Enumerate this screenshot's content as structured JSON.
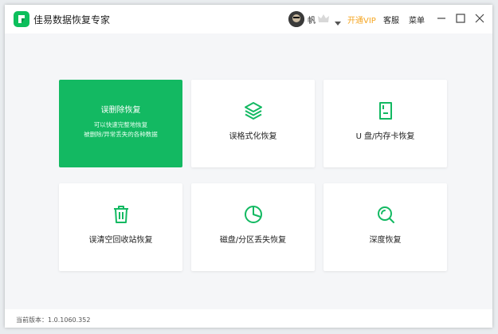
{
  "app": {
    "title": "佳易数据恢复专家"
  },
  "user": {
    "name": "帆"
  },
  "header": {
    "vip_label": "开通VIP",
    "service_label": "客服",
    "menu_label": "菜单"
  },
  "cards": [
    {
      "title": "误删除恢复",
      "desc1": "可以快速完整地恢复",
      "desc2": "被删除/异常丢失的各种数据",
      "icon": "recovery-icon"
    },
    {
      "label": "误格式化恢复",
      "icon": "layers-icon"
    },
    {
      "label": "U 盘/内存卡恢复",
      "icon": "sd-card-icon"
    },
    {
      "label": "误清空回收站恢复",
      "icon": "trash-icon"
    },
    {
      "label": "磁盘/分区丢失恢复",
      "icon": "pie-chart-icon"
    },
    {
      "label": "深度恢复",
      "icon": "search-icon"
    }
  ],
  "footer": {
    "version": "当前版本：1.0.1060.352"
  },
  "colors": {
    "accent": "#13b962",
    "vip": "#f5a623",
    "icon": "#13b962"
  }
}
